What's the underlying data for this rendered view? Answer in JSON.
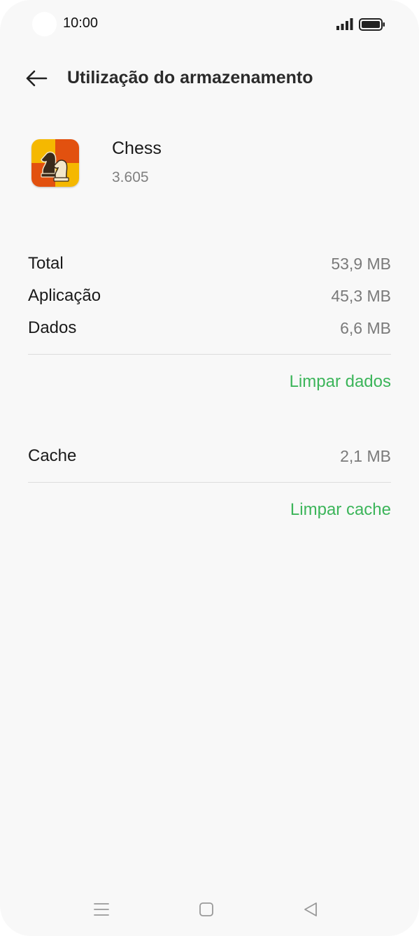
{
  "status_bar": {
    "time": "10:00",
    "icons": [
      "signal-icon",
      "battery-icon"
    ]
  },
  "header": {
    "title": "Utilização do armazenamento",
    "back_icon": "back-arrow-icon"
  },
  "app": {
    "name": "Chess",
    "version": "3.605",
    "icon": "chess-app-icon"
  },
  "storage": {
    "rows": [
      {
        "label": "Total",
        "value": "53,9 MB"
      },
      {
        "label": "Aplicação",
        "value": "45,3 MB"
      },
      {
        "label": "Dados",
        "value": "6,6 MB"
      }
    ],
    "clear_data_label": "Limpar dados"
  },
  "cache": {
    "label": "Cache",
    "value": "2,1 MB",
    "clear_cache_label": "Limpar cache"
  },
  "nav_bar": {
    "icons": [
      "menu-icon",
      "home-icon",
      "back-triangle-icon"
    ]
  },
  "colors": {
    "accent": "#3cb55a",
    "background": "#f8f8f8",
    "secondary_text": "#7a7a7a"
  }
}
